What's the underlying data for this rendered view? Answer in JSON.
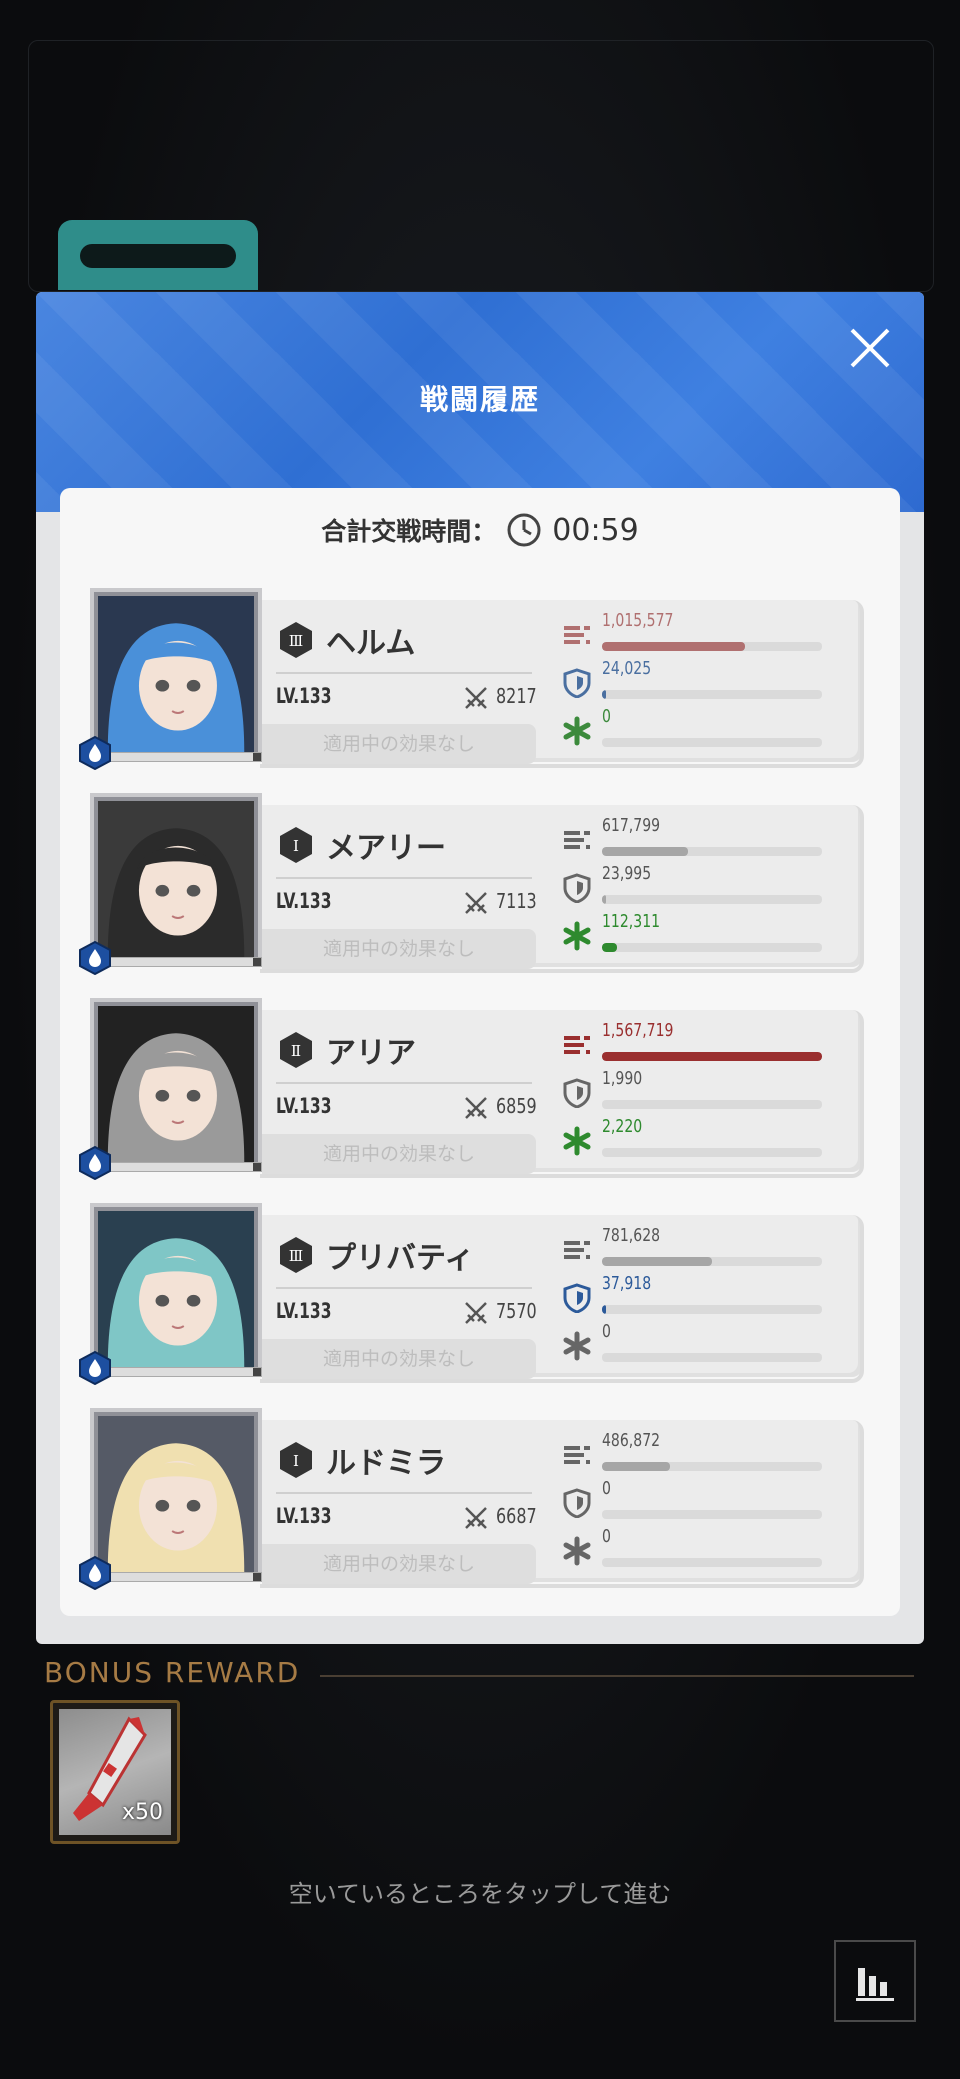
{
  "modal": {
    "title": "戦闘履歴",
    "total_label": "合計交戦時間：",
    "total_time": "00:59"
  },
  "characters": [
    {
      "name": "ヘルム",
      "rank": "Ⅲ",
      "level": "LV.133",
      "power": "8217",
      "effect": "適用中の効果なし",
      "damage": "1,015,577",
      "damage_ratio": 0.65,
      "damage_color": "#b07070",
      "taken": "24,025",
      "taken_ratio": 0.02,
      "taken_color": "#4a6fa0",
      "heal": "0",
      "heal_ratio": 0,
      "heal_color": "#3c8a3c",
      "portrait_hair": "#4a90d9",
      "portrait_bg": "#2a3850"
    },
    {
      "name": "メアリー",
      "rank": "Ⅰ",
      "level": "LV.133",
      "power": "7113",
      "effect": "適用中の効果なし",
      "damage": "617,799",
      "damage_ratio": 0.39,
      "damage_color": "#a6a6a6",
      "taken": "23,995",
      "taken_ratio": 0.02,
      "taken_color": "#a6a6a6",
      "heal": "112,311",
      "heal_ratio": 0.07,
      "heal_color": "#2e8a2e",
      "portrait_hair": "#2b2b2b",
      "portrait_bg": "#3a3a3a"
    },
    {
      "name": "アリア",
      "rank": "Ⅱ",
      "level": "LV.133",
      "power": "6859",
      "effect": "適用中の効果なし",
      "damage": "1,567,719",
      "damage_ratio": 1.0,
      "damage_color": "#9a2f2f",
      "taken": "1,990",
      "taken_ratio": 0.0,
      "taken_color": "#a6a6a6",
      "heal": "2,220",
      "heal_ratio": 0.0,
      "heal_color": "#2e8a2e",
      "portrait_hair": "#9a9a9a",
      "portrait_bg": "#222222"
    },
    {
      "name": "プリバティ",
      "rank": "Ⅲ",
      "level": "LV.133",
      "power": "7570",
      "effect": "適用中の効果なし",
      "damage": "781,628",
      "damage_ratio": 0.5,
      "damage_color": "#a6a6a6",
      "taken": "37,918",
      "taken_ratio": 0.02,
      "taken_color": "#2c5a9a",
      "heal": "0",
      "heal_ratio": 0,
      "heal_color": "#a6a6a6",
      "portrait_hair": "#7fc6c6",
      "portrait_bg": "#2a4050"
    },
    {
      "name": "ルドミラ",
      "rank": "Ⅰ",
      "level": "LV.133",
      "power": "6687",
      "effect": "適用中の効果なし",
      "damage": "486,872",
      "damage_ratio": 0.31,
      "damage_color": "#a6a6a6",
      "taken": "0",
      "taken_ratio": 0,
      "taken_color": "#a6a6a6",
      "heal": "0",
      "heal_ratio": 0,
      "heal_color": "#a6a6a6",
      "portrait_hair": "#f0e0b0",
      "portrait_bg": "#555a66"
    }
  ],
  "bonus": {
    "title": "BONUS REWARD",
    "item_qty": "x50"
  },
  "footer": {
    "hint": "空いているところをタップして進む"
  },
  "icons": {
    "close": "close-icon",
    "clock": "clock-icon",
    "damage": "ammo-icon",
    "taken": "shield-icon",
    "heal": "heal-icon",
    "power": "crossed-swords-icon",
    "element": "water-element-icon",
    "stats": "bar-chart-icon"
  }
}
